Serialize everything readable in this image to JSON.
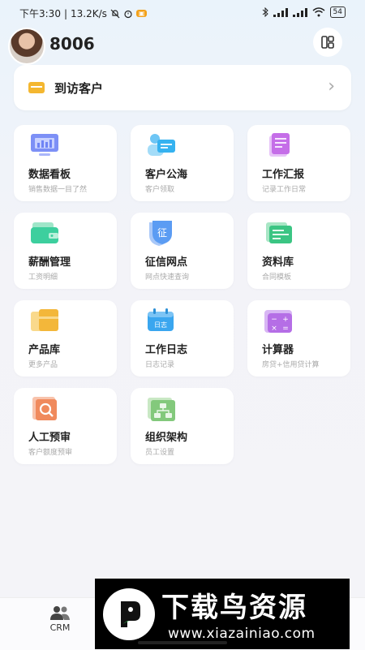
{
  "status_bar": {
    "time": "下午3:30",
    "net_speed": "13.2K/s",
    "battery": "54",
    "accent": "#f3a11b"
  },
  "header": {
    "username": "8006",
    "layout_icon": "grid-layout-icon"
  },
  "visit_card": {
    "label": "到访客户",
    "icon": "card-icon"
  },
  "tiles": [
    {
      "title": "数据看板",
      "subtitle": "销售数据一目了然",
      "icon": "monitor-chart-icon",
      "color": "#6f84f5"
    },
    {
      "title": "客户公海",
      "subtitle": "客户领取",
      "icon": "customer-card-icon",
      "color": "#35b2f0"
    },
    {
      "title": "工作汇报",
      "subtitle": "记录工作日常",
      "icon": "report-doc-icon",
      "color": "#c56ee8"
    },
    {
      "title": "薪酬管理",
      "subtitle": "工资明细",
      "icon": "wallet-icon",
      "color": "#3dcf9e"
    },
    {
      "title": "征信网点",
      "subtitle": "网点快速查询",
      "icon": "credit-shield-icon",
      "color": "#5b9cf3"
    },
    {
      "title": "资料库",
      "subtitle": "合同模板",
      "icon": "database-icon",
      "color": "#3bc583"
    },
    {
      "title": "产品库",
      "subtitle": "更多产品",
      "icon": "product-box-icon",
      "color": "#f3b73a"
    },
    {
      "title": "工作日志",
      "subtitle": "日志记录",
      "icon": "calendar-log-icon",
      "color": "#3aa6ef"
    },
    {
      "title": "计算器",
      "subtitle": "房贷+信用贷计算",
      "icon": "calculator-icon",
      "color": "#b56ee6"
    },
    {
      "title": "人工预审",
      "subtitle": "客户额度预审",
      "icon": "search-doc-icon",
      "color": "#f08a5d"
    },
    {
      "title": "组织架构",
      "subtitle": "员工设置",
      "icon": "org-chart-icon",
      "color": "#83c97c"
    }
  ],
  "bottom_nav": {
    "crm_label": "CRM",
    "crm_icon": "people-icon"
  },
  "watermark": {
    "title": "下载鸟资源",
    "url": "www.xiazainiao.com"
  }
}
